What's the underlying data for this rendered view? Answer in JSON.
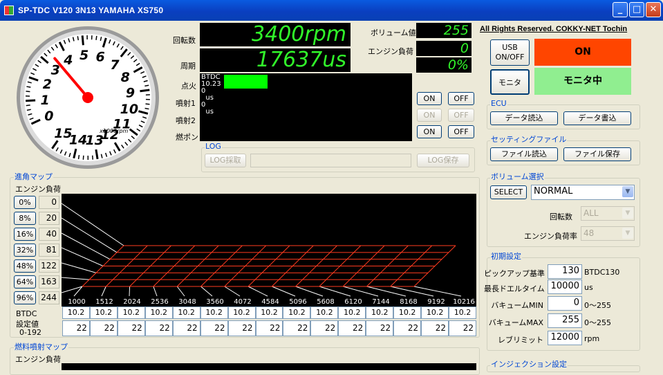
{
  "window": {
    "title": "SP-TDC V120 3N13  YAMAHA XS750",
    "min": "_",
    "max": "□",
    "close": "✕"
  },
  "gauge": {
    "ticks": [
      "0",
      "1",
      "2",
      "3",
      "4",
      "5",
      "6",
      "7",
      "8",
      "9",
      "10",
      "11",
      "12",
      "13",
      "14",
      "15"
    ],
    "unit": "x1000rpm",
    "value": 3.4,
    "max": 15
  },
  "readouts": {
    "rpm_label": "回転数",
    "rpm": "3400rpm",
    "period_label": "周期",
    "period": "17637us",
    "volume_label": "ボリューム値",
    "volume": "255",
    "load_label": "エンジン負荷",
    "load": "0",
    "load_pct": "0%"
  },
  "copyright": "All Rights Reserved. COKKY-NET Tochin",
  "usb": {
    "button": "USB\nON/OFF",
    "status": "ON",
    "status_color": "#ff4500"
  },
  "monitor": {
    "button": "モニタ",
    "status": "モニタ中",
    "status_color": "#90ee90"
  },
  "ignition": {
    "labels": [
      "点火",
      "噴射1",
      "噴射2",
      "燃ポン"
    ],
    "console": [
      "BTDC",
      "10.23",
      "0",
      "  us",
      "0",
      "  us"
    ],
    "bar_fraction": 0.53,
    "buttons": [
      {
        "on": "ON",
        "off": "OFF",
        "enabled": true
      },
      {
        "on": "ON",
        "off": "OFF",
        "enabled": false
      },
      {
        "on": "ON",
        "off": "OFF",
        "enabled": true
      }
    ]
  },
  "log": {
    "title": "LOG",
    "capture": "LOG採取",
    "save": "LOG保存"
  },
  "ecu": {
    "title": "ECU",
    "read": "データ読込",
    "write": "データ書込"
  },
  "settings_file": {
    "title": "セッティングファイル",
    "read": "ファイル読込",
    "save": "ファイル保存"
  },
  "volume_select": {
    "title": "ボリューム選択",
    "select_button": "SELECT",
    "selected": "NORMAL",
    "rpm_label": "回転数",
    "rpm_value": "ALL",
    "load_label": "エンジン負荷率",
    "load_value": "48"
  },
  "initial": {
    "title": "初期設定",
    "rows": [
      {
        "label": "ピックアップ基準",
        "value": "130",
        "unit": "BTDC130"
      },
      {
        "label": "最長ドエルタイム",
        "value": "10000",
        "unit": "us"
      },
      {
        "label": "バキュームMIN",
        "value": "0",
        "unit": "0〜255"
      },
      {
        "label": "バキュームMAX",
        "value": "255",
        "unit": "0〜255"
      },
      {
        "label": "レブリミット",
        "value": "12000",
        "unit": "rpm"
      }
    ]
  },
  "advance_map": {
    "title": "進角マップ",
    "load_label": "エンジン負荷",
    "load_buttons": [
      "0%",
      "8%",
      "16%",
      "32%",
      "48%",
      "64%",
      "96%"
    ],
    "load_values": [
      "0",
      "20",
      "40",
      "81",
      "122",
      "163",
      "244"
    ],
    "rpm_axis": [
      "1000",
      "1512",
      "2024",
      "2536",
      "3048",
      "3560",
      "4072",
      "4584",
      "5096",
      "5608",
      "6120",
      "7144",
      "8168",
      "9192",
      "10216"
    ],
    "btdc_label": "BTDC",
    "btdc_values": [
      "10.2",
      "10.2",
      "10.2",
      "10.2",
      "10.2",
      "10.2",
      "10.2",
      "10.2",
      "10.2",
      "10.2",
      "10.2",
      "10.2",
      "10.2",
      "10.2",
      "10.2"
    ],
    "set_label": "設定値",
    "set_range": "0-192",
    "set_values": [
      "22",
      "22",
      "22",
      "22",
      "22",
      "22",
      "22",
      "22",
      "22",
      "22",
      "22",
      "22",
      "22",
      "22",
      "22"
    ]
  },
  "fuel_map": {
    "title": "燃料噴射マップ",
    "load_label": "エンジン負荷"
  },
  "injection": {
    "title": "インジェクション設定"
  }
}
